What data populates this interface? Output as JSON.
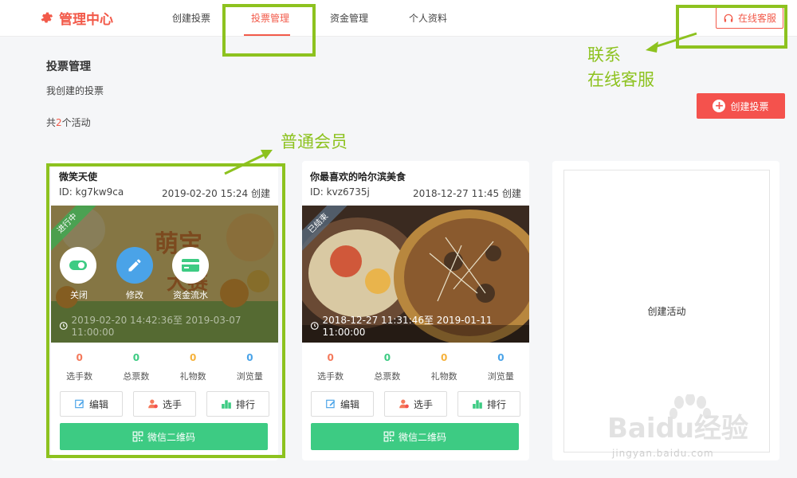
{
  "header": {
    "logo_text": "管理中心",
    "nav": [
      "创建投票",
      "投票管理",
      "资金管理",
      "个人资料"
    ],
    "service_label": "在线客服"
  },
  "page": {
    "title": "投票管理",
    "subtitle": "我创建的投票",
    "count_prefix": "共",
    "count_value": "2",
    "count_suffix": "个活动",
    "create_button": "创建投票"
  },
  "cards": [
    {
      "title": "微笑天使",
      "id": "ID: kg7kw9ca",
      "date": "2019-02-20 15:24 创建",
      "status": "进行中",
      "time_range": "2019-02-20 14:42:36至 2019-03-07 11:00:00",
      "overlay": [
        "关闭",
        "修改",
        "资金流水"
      ],
      "poster_text": "萌宝大赛",
      "stats": [
        {
          "value": "0",
          "label": "选手数",
          "color": "#f4795b"
        },
        {
          "value": "0",
          "label": "总票数",
          "color": "#3dcb83"
        },
        {
          "value": "0",
          "label": "礼物数",
          "color": "#f6b23c"
        },
        {
          "value": "0",
          "label": "浏览量",
          "color": "#4aa3e8"
        }
      ],
      "actions": [
        "编辑",
        "选手",
        "排行"
      ],
      "qr_label": "微信二维码"
    },
    {
      "title": "你最喜欢的哈尔滨美食",
      "id": "ID: kvz6735j",
      "date": "2018-12-27 11:45 创建",
      "status": "已结束",
      "time_range": "2018-12-27 11:31:46至 2019-01-11 11:00:00",
      "stats": [
        {
          "value": "0",
          "label": "选手数",
          "color": "#f4795b"
        },
        {
          "value": "0",
          "label": "总票数",
          "color": "#3dcb83"
        },
        {
          "value": "0",
          "label": "礼物数",
          "color": "#f6b23c"
        },
        {
          "value": "0",
          "label": "浏览量",
          "color": "#4aa3e8"
        }
      ],
      "actions": [
        "编辑",
        "选手",
        "排行"
      ],
      "qr_label": "微信二维码"
    }
  ],
  "create_card_label": "创建活动",
  "annotations": {
    "contact_line1": "联系",
    "contact_line2": "在线客服",
    "member": "普通会员"
  },
  "watermark": {
    "brand": "Baidu经验",
    "url": "jingyan.baidu.com"
  },
  "colors": {
    "accent": "#f25a4a",
    "green": "#3dcb83",
    "annotation": "#8dc21f"
  }
}
